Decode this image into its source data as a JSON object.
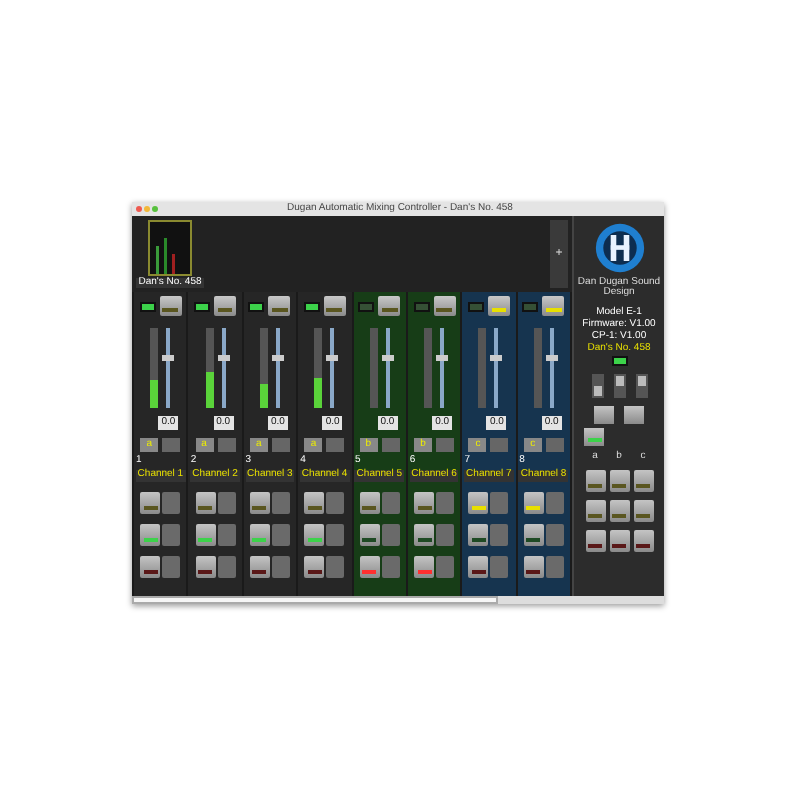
{
  "window": {
    "title": "Dugan Automatic Mixing Controller - Dan's No. 458"
  },
  "overview": {
    "label": "Dan's No. 458",
    "add": "+"
  },
  "channels": [
    {
      "number": "1",
      "name": "Channel 1",
      "color": "#262626",
      "level_on": true,
      "value": "0.0",
      "group": "a",
      "meter": {
        "level": 0.35
      },
      "weight": {
        "level": 0.62
      },
      "buttons": [
        {
          "kind": "amber",
          "lit": false
        },
        {
          "kind": "green",
          "lit": true
        },
        {
          "kind": "red",
          "lit": false
        }
      ]
    },
    {
      "number": "2",
      "name": "Channel 2",
      "color": "#262626",
      "level_on": true,
      "value": "0.0",
      "group": "a",
      "meter": {
        "level": 0.45
      },
      "weight": {
        "level": 0.62
      },
      "buttons": [
        {
          "kind": "amber",
          "lit": false
        },
        {
          "kind": "green",
          "lit": true
        },
        {
          "kind": "red",
          "lit": false
        }
      ]
    },
    {
      "number": "3",
      "name": "Channel 3",
      "color": "#262626",
      "level_on": true,
      "value": "0.0",
      "group": "a",
      "meter": {
        "level": 0.3
      },
      "weight": {
        "level": 0.62
      },
      "buttons": [
        {
          "kind": "amber",
          "lit": false
        },
        {
          "kind": "green",
          "lit": true
        },
        {
          "kind": "red",
          "lit": false
        }
      ]
    },
    {
      "number": "4",
      "name": "Channel 4",
      "color": "#262626",
      "level_on": true,
      "value": "0.0",
      "group": "a",
      "meter": {
        "level": 0.38
      },
      "weight": {
        "level": 0.62
      },
      "buttons": [
        {
          "kind": "amber",
          "lit": false
        },
        {
          "kind": "green",
          "lit": true
        },
        {
          "kind": "red",
          "lit": false
        }
      ]
    },
    {
      "number": "5",
      "name": "Channel 5",
      "color": "#173d17",
      "level_on": false,
      "value": "0.0",
      "group": "b",
      "meter": {
        "level": 0.0
      },
      "weight": {
        "level": 0.62
      },
      "buttons": [
        {
          "kind": "amber",
          "lit": false
        },
        {
          "kind": "green",
          "lit": false
        },
        {
          "kind": "red",
          "lit": true
        }
      ]
    },
    {
      "number": "6",
      "name": "Channel 6",
      "color": "#173d17",
      "level_on": false,
      "value": "0.0",
      "group": "b",
      "meter": {
        "level": 0.0
      },
      "weight": {
        "level": 0.62
      },
      "buttons": [
        {
          "kind": "amber",
          "lit": false
        },
        {
          "kind": "green",
          "lit": false
        },
        {
          "kind": "red",
          "lit": true
        }
      ]
    },
    {
      "number": "7",
      "name": "Channel 7",
      "color": "#16344f",
      "level_on": false,
      "value": "0.0",
      "group": "c",
      "meter": {
        "level": 0.0
      },
      "weight": {
        "level": 0.62
      },
      "buttons": [
        {
          "kind": "amber",
          "lit": true
        },
        {
          "kind": "green",
          "lit": false
        },
        {
          "kind": "red",
          "lit": false
        }
      ]
    },
    {
      "number": "8",
      "name": "Channel 8",
      "color": "#16344f",
      "level_on": false,
      "value": "0.0",
      "group": "c",
      "meter": {
        "level": 0.0
      },
      "weight": {
        "level": 0.62
      },
      "buttons": [
        {
          "kind": "amber",
          "lit": true
        },
        {
          "kind": "green",
          "lit": false
        },
        {
          "kind": "red",
          "lit": false
        }
      ]
    }
  ],
  "panel": {
    "brand": "Dan Dugan Sound Design",
    "info": [
      "Model E-1",
      "Firmware: V1.00",
      "CP-1: V1.00"
    ],
    "unit": "Dan's No. 458",
    "status_on": true,
    "switches": [
      {
        "on": false
      },
      {
        "on": true
      },
      {
        "on": true
      }
    ],
    "override_on": true,
    "groups": [
      {
        "label": "a"
      },
      {
        "label": "b"
      },
      {
        "label": "c"
      }
    ]
  }
}
